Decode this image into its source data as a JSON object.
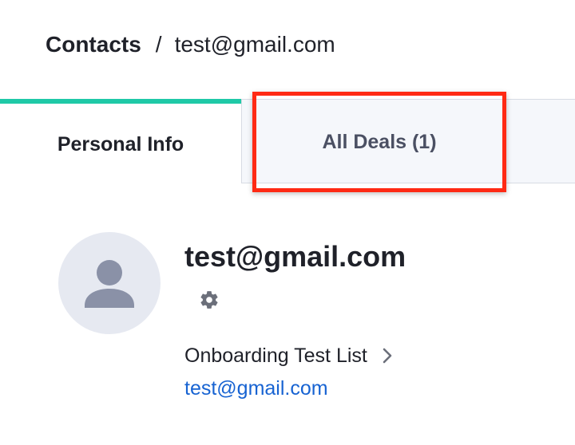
{
  "breadcrumb": {
    "root": "Contacts",
    "separator": "/",
    "current": "test@gmail.com"
  },
  "tabs": [
    {
      "label": "Personal Info",
      "active": true
    },
    {
      "label": "All Deals (1)",
      "active": false
    }
  ],
  "contact": {
    "name": "test@gmail.com",
    "list": "Onboarding Test List",
    "email": "test@gmail.com"
  },
  "icons": {
    "avatar": "person-icon",
    "settings": "gear-icon",
    "list_arrow": "chevron-right-icon"
  },
  "colors": {
    "active_tab_accent": "#1fc9a7",
    "highlight": "#ff2a14",
    "link": "#1763d2",
    "inactive_tab_bg": "#f5f7fb"
  }
}
